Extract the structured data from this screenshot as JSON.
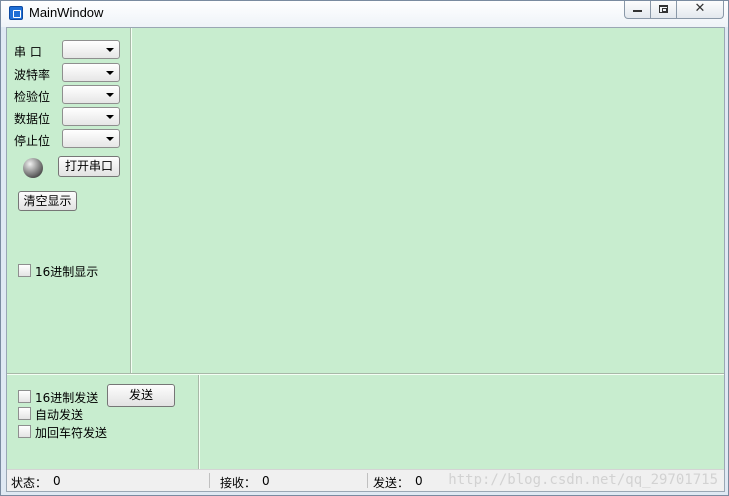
{
  "window": {
    "title": "MainWindow"
  },
  "serial_settings": {
    "port_label": "串  口",
    "baud_label": "波特率",
    "parity_label": "检验位",
    "databits_label": "数据位",
    "stopbits_label": "停止位"
  },
  "buttons": {
    "open_port": "打开串口",
    "clear_display": "清空显示",
    "send": "发送"
  },
  "checkboxes": {
    "hex_display": "16进制显示",
    "hex_send": "16进制发送",
    "auto_send": "自动发送",
    "add_cr_send": "加回车符发送"
  },
  "status": {
    "state_label": "状态：",
    "state_value": "0",
    "recv_label": "接收：",
    "recv_value": "0",
    "send_label": "发送：",
    "send_value": "0"
  },
  "watermark": "http://blog.csdn.net/qq_29701715",
  "colors": {
    "client_bg": "#c8edcf",
    "status_bg": "#f0f0f0"
  }
}
